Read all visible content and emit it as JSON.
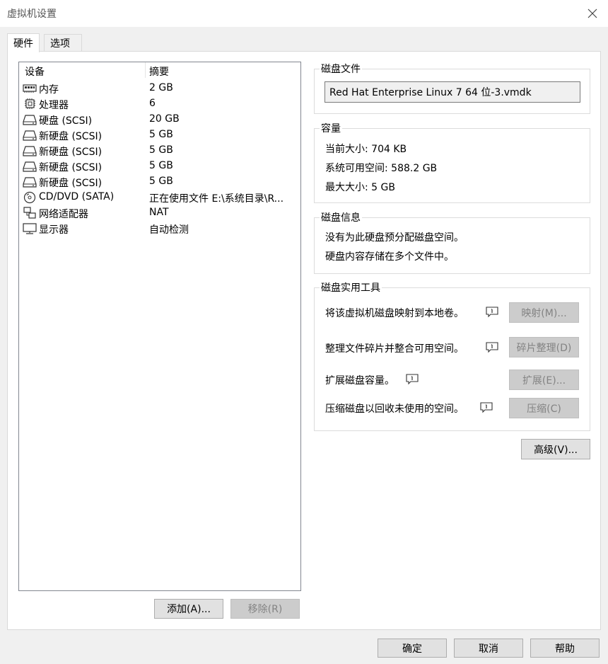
{
  "window": {
    "title": "虚拟机设置"
  },
  "tabs": [
    {
      "label": "硬件"
    },
    {
      "label": "选项"
    }
  ],
  "device_list": {
    "columns": [
      "设备",
      "摘要"
    ],
    "rows": [
      {
        "name": "内存",
        "summary": "2 GB",
        "icon": "memory-icon"
      },
      {
        "name": "处理器",
        "summary": "6",
        "icon": "processor-icon"
      },
      {
        "name": "硬盘 (SCSI)",
        "summary": "20 GB",
        "icon": "hard-disk-icon"
      },
      {
        "name": "新硬盘 (SCSI)",
        "summary": "5 GB",
        "icon": "hard-disk-icon"
      },
      {
        "name": "新硬盘 (SCSI)",
        "summary": "5 GB",
        "icon": "hard-disk-icon"
      },
      {
        "name": "新硬盘 (SCSI)",
        "summary": "5 GB",
        "icon": "hard-disk-icon"
      },
      {
        "name": "新硬盘 (SCSI)",
        "summary": "5 GB",
        "icon": "hard-disk-icon"
      },
      {
        "name": "CD/DVD (SATA)",
        "summary": "正在使用文件 E:\\系统目录\\R...",
        "icon": "cd-dvd-icon"
      },
      {
        "name": "网络适配器",
        "summary": "NAT",
        "icon": "network-adapter-icon"
      },
      {
        "name": "显示器",
        "summary": "自动检测",
        "icon": "monitor-icon"
      }
    ]
  },
  "list_buttons": {
    "add": "添加(A)...",
    "remove": "移除(R)"
  },
  "disk_file": {
    "title": "磁盘文件",
    "value": "Red Hat Enterprise Linux 7 64 位-3.vmdk"
  },
  "capacity": {
    "title": "容量",
    "current_size": "当前大小: 704 KB",
    "available_space": "系统可用空间: 588.2 GB",
    "max_size": "最大大小: 5 GB"
  },
  "disk_info": {
    "title": "磁盘信息",
    "line1": "没有为此硬盘预分配磁盘空间。",
    "line2": "硬盘内容存储在多个文件中。"
  },
  "disk_utilities": {
    "title": "磁盘实用工具",
    "items": [
      {
        "text": "将该虚拟机磁盘映射到本地卷。",
        "button": "映射(M)..."
      },
      {
        "text": "整理文件碎片并整合可用空间。",
        "button": "碎片整理(D)"
      },
      {
        "text": "扩展磁盘容量。",
        "button": "扩展(E)..."
      },
      {
        "text": "压缩磁盘以回收未使用的空间。",
        "button": "压缩(C)"
      }
    ]
  },
  "advanced_button": "高级(V)...",
  "footer": {
    "ok": "确定",
    "cancel": "取消",
    "help": "帮助"
  }
}
